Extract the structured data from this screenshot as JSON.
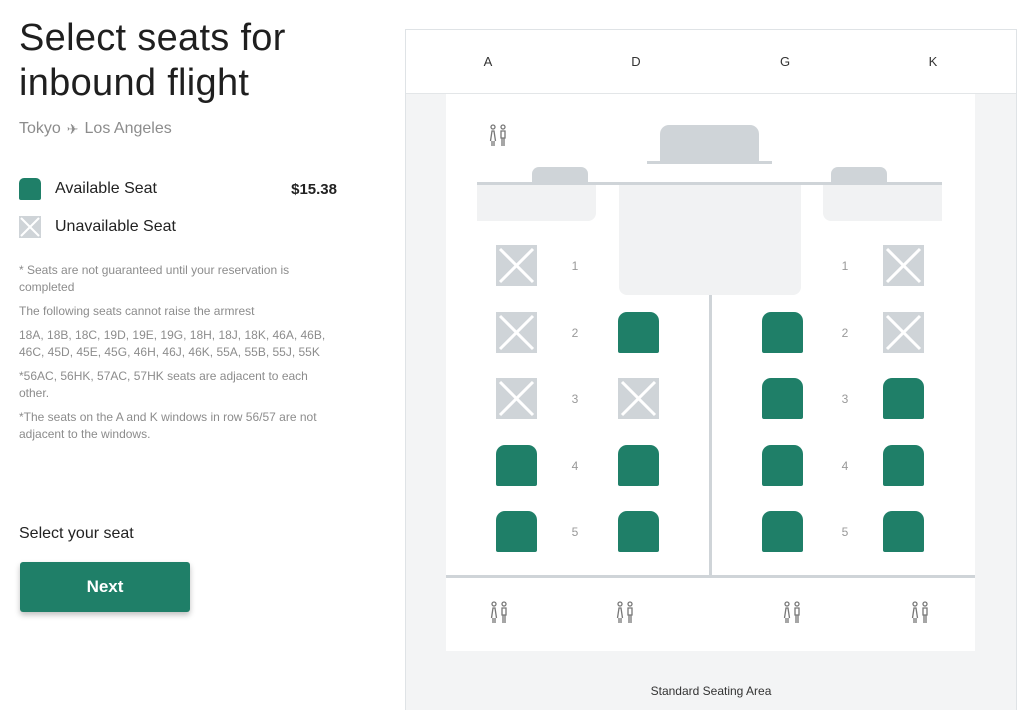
{
  "header": {
    "title": "Select seats for inbound flight",
    "route_from": "Tokyo",
    "route_to": "Los Angeles",
    "route_icon": "airplane-icon"
  },
  "legend": {
    "available_label": "Available Seat",
    "available_price": "$15.38",
    "unavailable_label": "Unavailable Seat"
  },
  "notes": [
    "* Seats are not guaranteed until your reservation is completed",
    "The following seats cannot raise the armrest",
    "18A, 18B, 18C, 19D, 19E, 19G, 18H, 18J, 18K, 46A, 46B, 46C, 45D, 45E, 45G, 46H, 46J, 46K, 55A, 55B, 55J, 55K",
    "*56AC, 56HK, 57AC, 57HK seats are adjacent to each other.",
    "*The seats on the A and K windows in row 56/57 are not adjacent to the windows."
  ],
  "selection": {
    "prompt": "Select your seat",
    "next_label": "Next"
  },
  "seat_map": {
    "columns": [
      "A",
      "D",
      "G",
      "K"
    ],
    "rows": [
      "1",
      "2",
      "3",
      "4",
      "5"
    ],
    "seat_status": {
      "1": {
        "A": "unavailable",
        "K": "unavailable"
      },
      "2": {
        "A": "unavailable",
        "D": "available",
        "G": "available",
        "K": "unavailable"
      },
      "3": {
        "A": "unavailable",
        "D": "unavailable",
        "G": "available",
        "K": "available"
      },
      "4": {
        "A": "available",
        "D": "available",
        "G": "available",
        "K": "available"
      },
      "5": {
        "A": "available",
        "D": "available",
        "G": "available",
        "K": "available"
      }
    },
    "footer_label": "Standard Seating Area",
    "colors": {
      "available": "#1f7f68",
      "unavailable": "#cfd4d8",
      "facility": "#cfd4d8"
    }
  }
}
